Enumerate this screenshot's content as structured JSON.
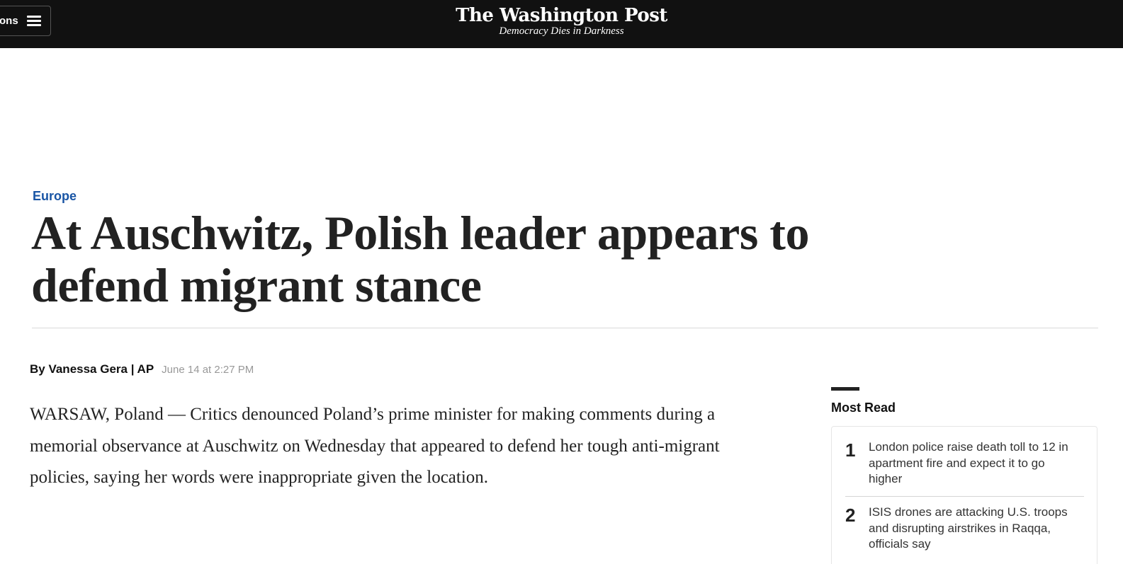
{
  "header": {
    "sections_label": "ons",
    "logo_name": "The Washington Post",
    "tagline": "Democracy Dies in Darkness"
  },
  "article": {
    "kicker": "Europe",
    "headline": "At Auschwitz, Polish leader appears to defend migrant stance",
    "byline": "By Vanessa Gera | AP",
    "timestamp": "June 14 at 2:27 PM",
    "lede": "WARSAW, Poland — Critics denounced Poland’s prime minister for making comments during a memorial observance at Auschwitz on Wednesday that appeared to defend her tough anti-migrant policies, saying her words were inappropriate given the location."
  },
  "most_read": {
    "title": "Most Read",
    "items": [
      {
        "rank": "1",
        "headline": "London police raise death toll to 12 in apartment fire and expect it to go higher"
      },
      {
        "rank": "2",
        "headline": "ISIS drones are attacking U.S. troops and disrupting airstrikes in Raqqa, officials say"
      }
    ]
  },
  "colors": {
    "topbar_bg": "#111111",
    "kicker": "#1955a5",
    "text": "#222222",
    "muted": "#999999"
  },
  "icons": {
    "menu": "hamburger-icon"
  }
}
